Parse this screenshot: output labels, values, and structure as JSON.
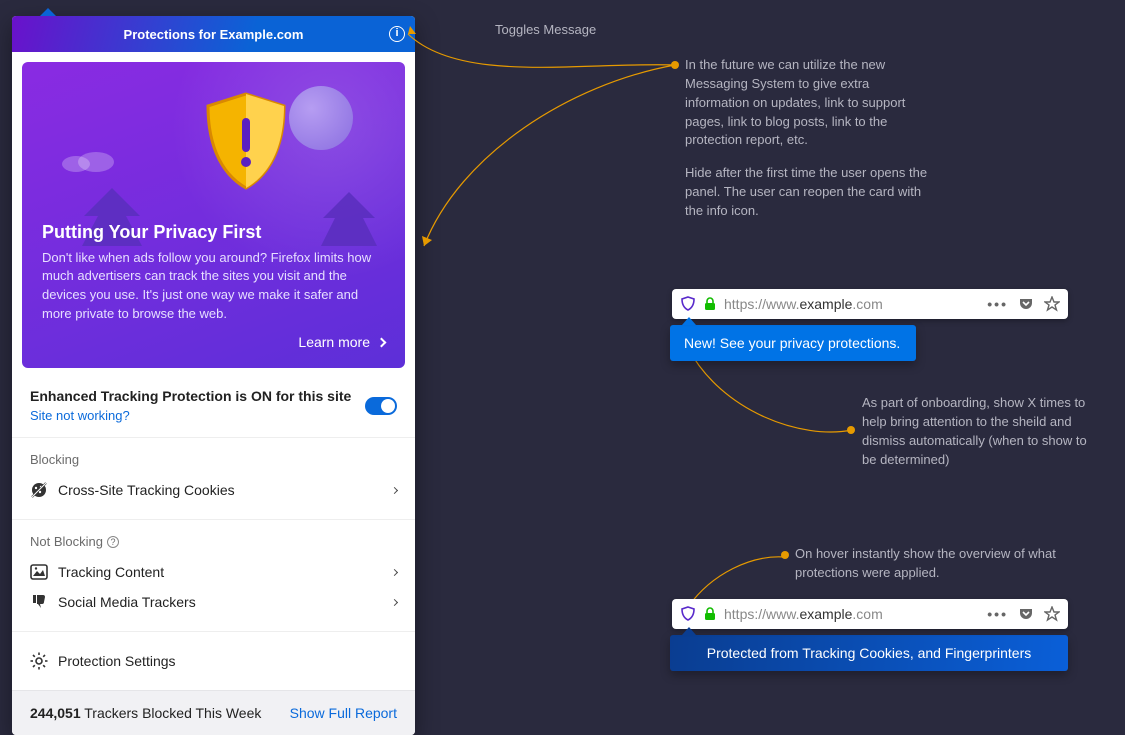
{
  "panel": {
    "title": "Protections for Example.com"
  },
  "hero": {
    "heading": "Putting Your Privacy First",
    "body": "Don't like when ads follow you around? Firefox limits how much advertisers can track the sites you visit and the devices you use. It's just one way we make it safer and more private to browse the web.",
    "learn_more": "Learn more"
  },
  "etp": {
    "title": "Enhanced Tracking Protection is ON for this site",
    "link": "Site not working?"
  },
  "blocking": {
    "heading": "Blocking",
    "items": [
      "Cross-Site Tracking Cookies"
    ]
  },
  "not_blocking": {
    "heading": "Not Blocking",
    "items": [
      "Tracking Content",
      "Social Media Trackers"
    ]
  },
  "settings_label": "Protection Settings",
  "footer": {
    "count": "244,051",
    "tail": " Trackers Blocked This Week",
    "link": "Show Full Report"
  },
  "annotations": {
    "toggle_title": "Toggles Message",
    "messaging_p1": "In the future we can utilize the new Messaging System to give extra information on updates, link to support pages, link to blog posts, link to the protection report, etc.",
    "messaging_p2": "Hide after the first time the user opens the panel. The user can reopen the card with the info icon.",
    "onboarding": "As part of onboarding, show X times to help bring attention to the sheild and dismiss automatically (when to show to be determined)",
    "hover": "On hover instantly show the overview of what protections were applied."
  },
  "urlbar": {
    "prefix": "https://www.",
    "domain": "example",
    "suffix": ".com"
  },
  "callouts": {
    "new": "New! See your privacy protections.",
    "protected": "Protected from Tracking Cookies, and Fingerprinters"
  }
}
